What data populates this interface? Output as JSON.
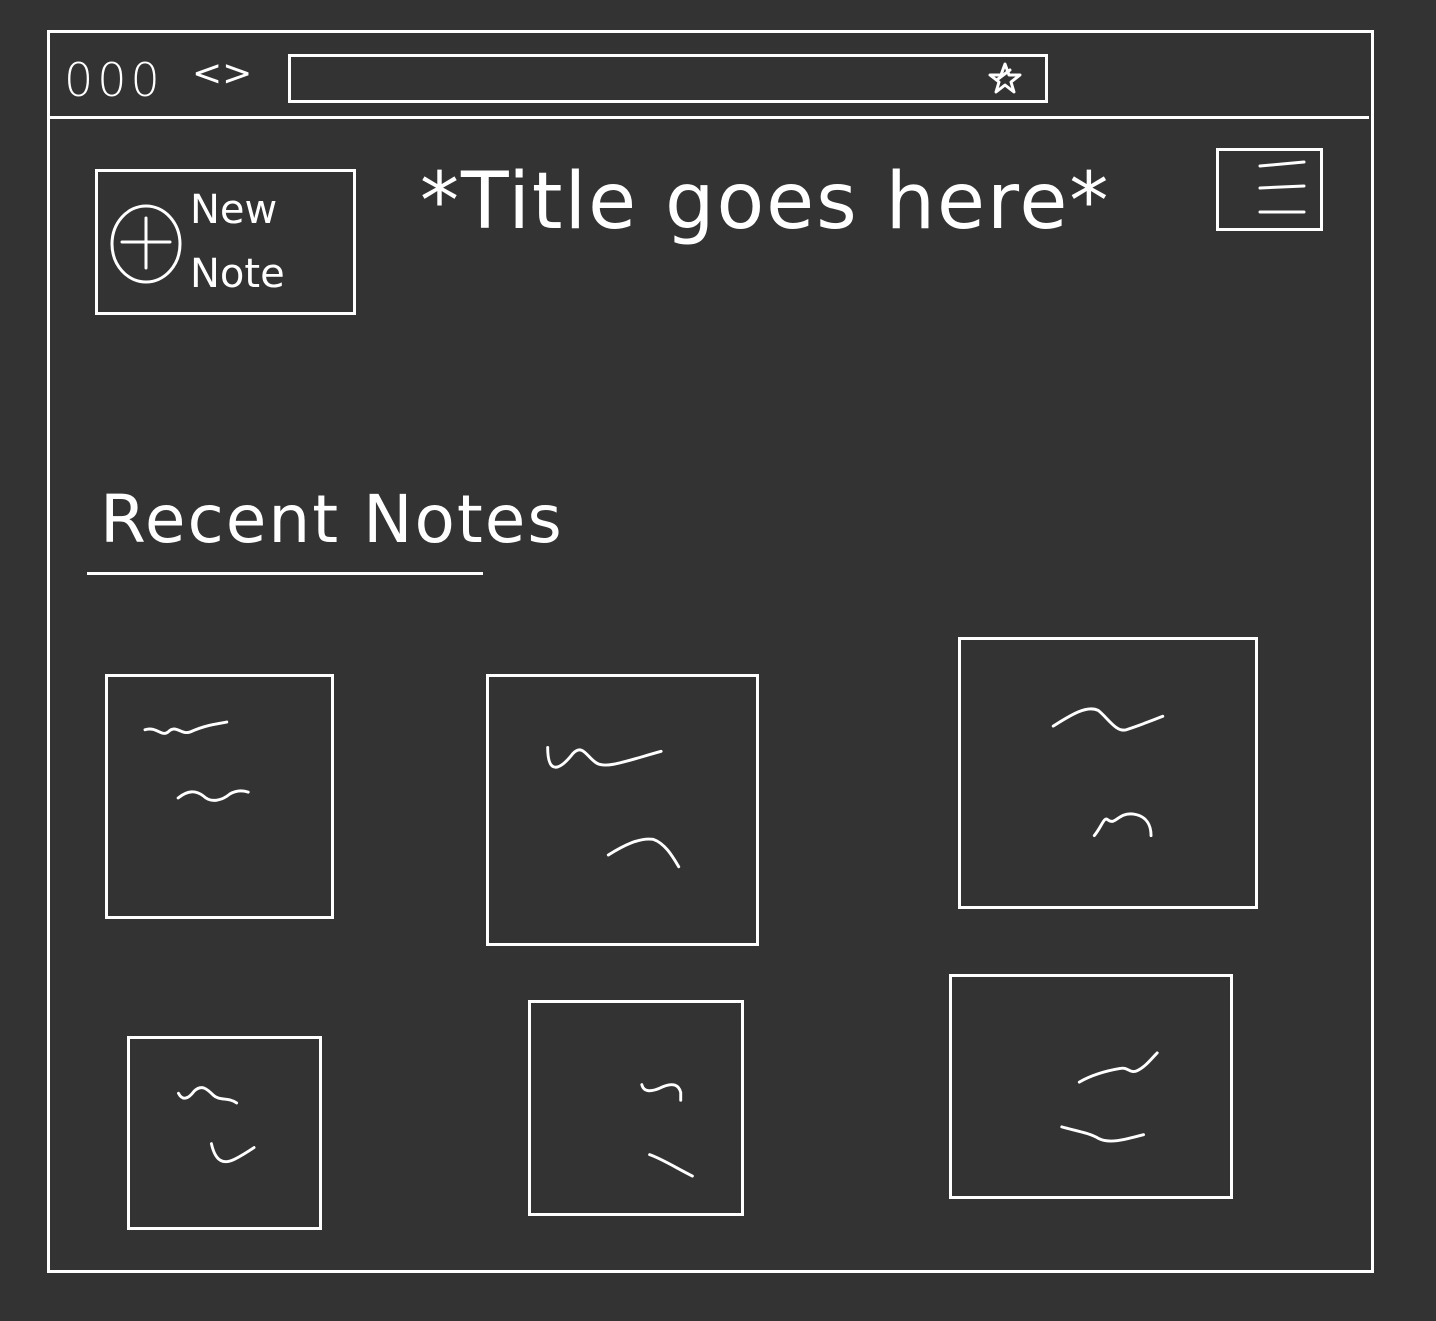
{
  "browser": {
    "window_controls": "000",
    "nav_arrows": "<>",
    "bookmark_icon": "star-icon"
  },
  "header": {
    "new_note_label": "New\nNote",
    "new_note_icon": "plus-circle-icon",
    "title": "*Title goes here*",
    "menu_icon": "hamburger-menu-icon"
  },
  "recent": {
    "heading": "Recent Notes",
    "cards": [
      {
        "name": "note-card-1"
      },
      {
        "name": "note-card-2"
      },
      {
        "name": "note-card-3"
      },
      {
        "name": "note-card-4"
      },
      {
        "name": "note-card-5"
      },
      {
        "name": "note-card-6"
      }
    ]
  },
  "colors": {
    "background": "#333333",
    "stroke": "#ffffff"
  }
}
